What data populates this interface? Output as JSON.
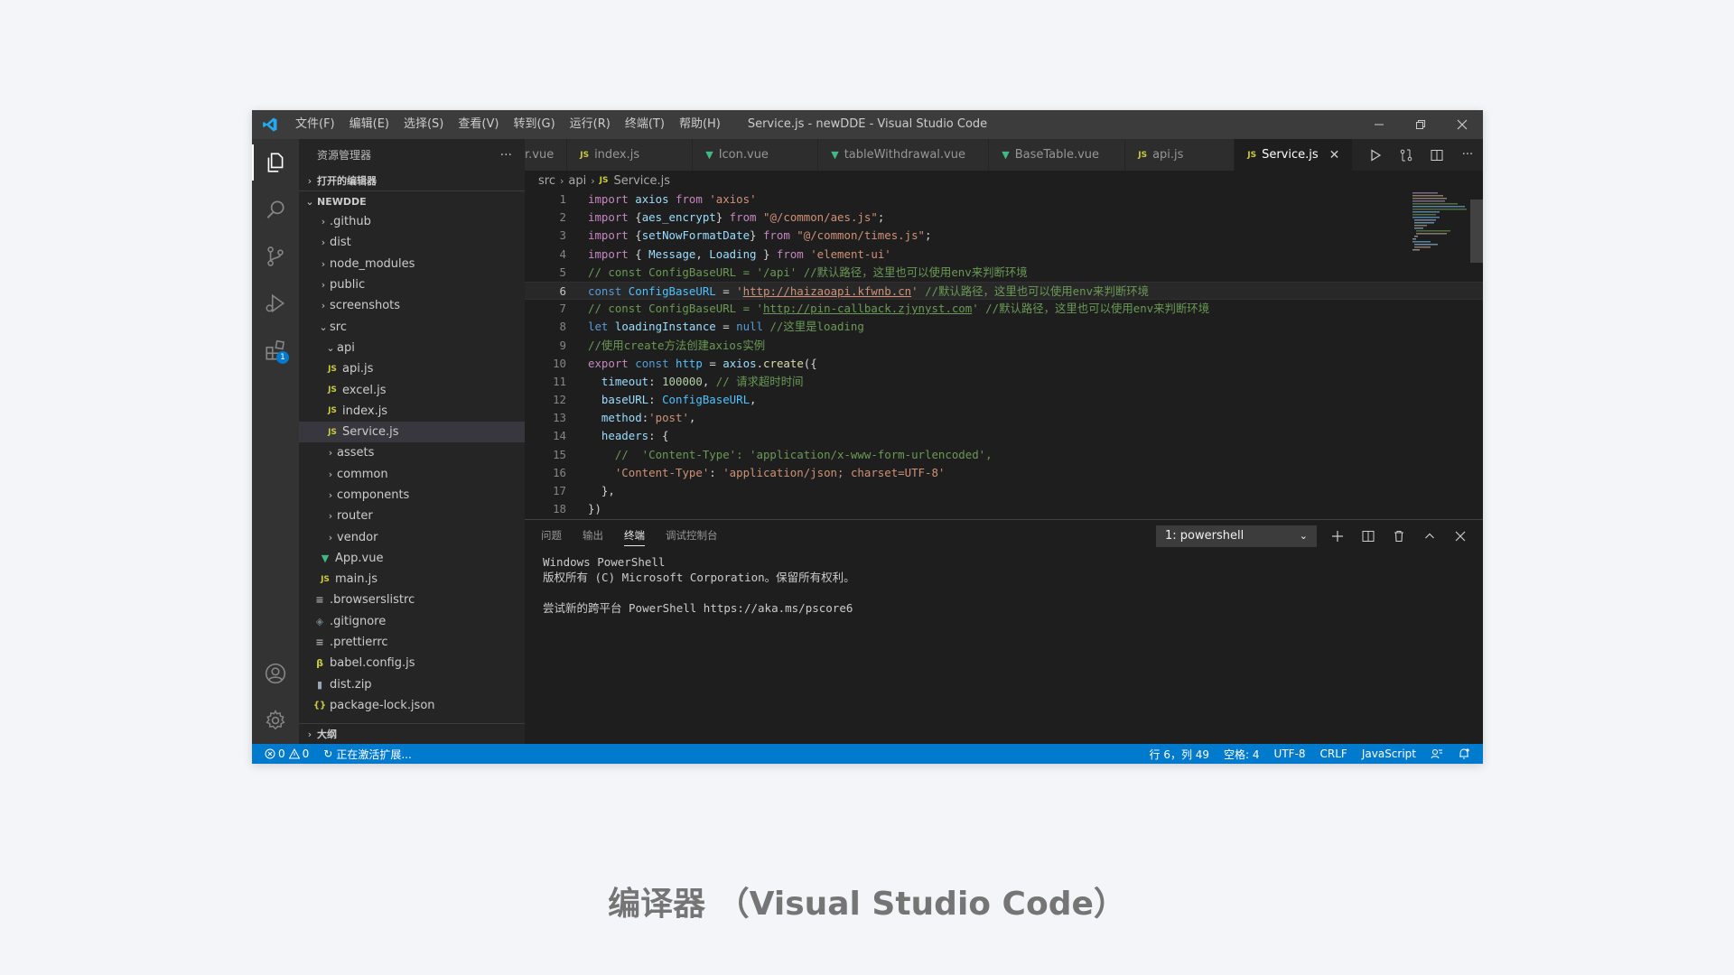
{
  "titlebar": {
    "menus": [
      "文件(F)",
      "编辑(E)",
      "选择(S)",
      "查看(V)",
      "转到(G)",
      "运行(R)",
      "终端(T)",
      "帮助(H)"
    ],
    "title": "Service.js - newDDE - Visual Studio Code"
  },
  "activity_bar": {
    "extensions_badge": "1"
  },
  "sidebar": {
    "header": "资源管理器",
    "more": "···",
    "open_editors": "打开的编辑器",
    "project": "NEWDDE",
    "tree": [
      {
        "label": ".github",
        "chevron": "›",
        "icon": ""
      },
      {
        "label": "dist",
        "chevron": "›",
        "icon": ""
      },
      {
        "label": "node_modules",
        "chevron": "›",
        "icon": ""
      },
      {
        "label": "public",
        "chevron": "›",
        "icon": ""
      },
      {
        "label": "screenshots",
        "chevron": "›",
        "icon": ""
      },
      {
        "label": "src",
        "chevron": "⌄",
        "icon": ""
      },
      {
        "label": "api",
        "chevron": "⌄",
        "icon": ""
      },
      {
        "label": "api.js",
        "chevron": "",
        "icon": "JS"
      },
      {
        "label": "excel.js",
        "chevron": "",
        "icon": "JS"
      },
      {
        "label": "index.js",
        "chevron": "",
        "icon": "JS"
      },
      {
        "label": "Service.js",
        "chevron": "",
        "icon": "JS"
      },
      {
        "label": "assets",
        "chevron": "›",
        "icon": ""
      },
      {
        "label": "common",
        "chevron": "›",
        "icon": ""
      },
      {
        "label": "components",
        "chevron": "›",
        "icon": ""
      },
      {
        "label": "router",
        "chevron": "›",
        "icon": ""
      },
      {
        "label": "vendor",
        "chevron": "›",
        "icon": ""
      },
      {
        "label": "App.vue",
        "chevron": "",
        "icon": "▼"
      },
      {
        "label": "main.js",
        "chevron": "",
        "icon": "JS"
      },
      {
        "label": ".browserslistrc",
        "chevron": "",
        "icon": "≡"
      },
      {
        "label": ".gitignore",
        "chevron": "",
        "icon": "◈"
      },
      {
        "label": ".prettierrc",
        "chevron": "",
        "icon": "≡"
      },
      {
        "label": "babel.config.js",
        "chevron": "",
        "icon": "β"
      },
      {
        "label": "dist.zip",
        "chevron": "",
        "icon": "▮"
      },
      {
        "label": "package-lock.json",
        "chevron": "",
        "icon": "{}"
      }
    ],
    "outline": "大纲"
  },
  "tabs": [
    {
      "label": "r.vue",
      "icon": ""
    },
    {
      "label": "index.js",
      "icon": "JS"
    },
    {
      "label": "Icon.vue",
      "icon": "▼"
    },
    {
      "label": "tableWithdrawal.vue",
      "icon": "▼"
    },
    {
      "label": "BaseTable.vue",
      "icon": "▼"
    },
    {
      "label": "api.js",
      "icon": "JS"
    },
    {
      "label": "Service.js",
      "icon": "JS"
    }
  ],
  "breadcrumb": {
    "parts": [
      "src",
      "api",
      "Service.js"
    ],
    "file_icon": "JS"
  },
  "code": {
    "line_numbers": [
      "1",
      "2",
      "3",
      "4",
      "5",
      "6",
      "7",
      "8",
      "9",
      "10",
      "11",
      "12",
      "13",
      "14",
      "15",
      "16",
      "17",
      "18"
    ],
    "t": {
      "import": "import",
      "from": "from",
      "const": "const",
      "let": "let",
      "null": "null",
      "export": "export",
      "axios": "axios",
      "axios_str": "'axios'",
      "aes_encrypt": "aes_encrypt",
      "aes_path": "\"@/common/aes.js\"",
      "setNowFormatDate": "setNowFormatDate",
      "times_path": "\"@/common/times.js\"",
      "Message": "Message",
      "Loading": "Loading",
      "eui": "'element-ui'",
      "c5": "// const ConfigBaseURL = '/api' //默认路径，这里也可以使用env来判断环境",
      "ConfigBaseURL": "ConfigBaseURL",
      "url6": "http://haizaoapi.kfwnb.cn",
      "c6": "//默认路径，这里也可以使用env来判断环境",
      "c7a": "// const ConfigBaseURL = '",
      "url7": "http://pin-callback.zjynyst.com",
      "c7b": "' //默认路径，这里也可以使用env来判断环境",
      "loadingInstance": "loadingInstance",
      "c8": "//这里是loading",
      "c9": "//使用create方法创建axios实例",
      "http": "http",
      "create": "create",
      "timeout": "timeout",
      "n100000": "100000",
      "c11": "// 请求超时时间",
      "baseURL": "baseURL",
      "method": "method",
      "post": "'post'",
      "headers": "headers",
      "c15": "//  'Content-Type': 'application/x-www-form-urlencoded',",
      "ct": "'Content-Type'",
      "ctv": "'application/json; charset=UTF-8'",
      "close17": "},",
      "close18": "})"
    }
  },
  "panel": {
    "tabs": [
      "问题",
      "输出",
      "终端",
      "调试控制台"
    ],
    "terminal_select": "1: powershell",
    "terminal_lines": [
      "Windows PowerShell",
      "版权所有 (C) Microsoft Corporation。保留所有权利。",
      "",
      "尝试新的跨平台 PowerShell https://aka.ms/pscore6"
    ]
  },
  "statusbar": {
    "errors": "0",
    "warnings": "0",
    "activating": "正在激活扩展...",
    "position": "行 6，列 49",
    "spaces": "空格: 4",
    "encoding": "UTF-8",
    "eol": "CRLF",
    "language": "JavaScript"
  },
  "caption": "编译器 （Visual Studio Code）",
  "colors": {
    "accent": "#007acc",
    "titlebar": "#3c3c3c",
    "sidebar": "#252526",
    "editor": "#1e1e1e"
  }
}
